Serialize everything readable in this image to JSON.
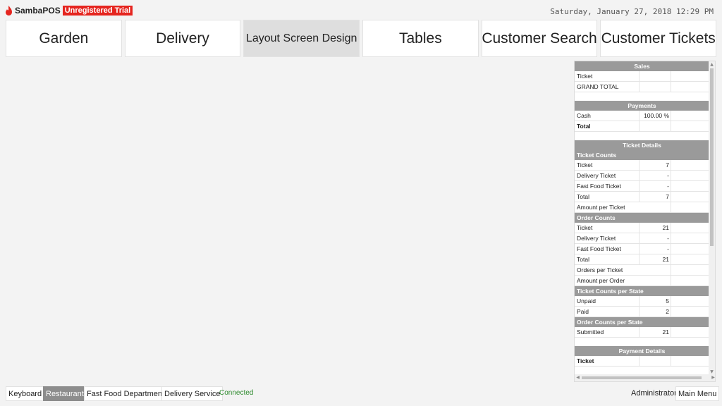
{
  "app": {
    "name": "SambaPOS",
    "trial_badge": "Unregistered Trial",
    "datetime": "Saturday, January 27, 2018 12:29 PM",
    "brand_color": "#e5251f"
  },
  "nav": {
    "garden": "Garden",
    "delivery": "Delivery",
    "layout_screen_design": "Layout Screen Design",
    "tables": "Tables",
    "customer_search": "Customer Search",
    "customer_tickets": "Customer Tickets",
    "active": "Layout Screen Design"
  },
  "report": {
    "sales": {
      "title": "Sales",
      "ticket": "Ticket",
      "grand_total": "GRAND TOTAL"
    },
    "payments": {
      "title": "Payments",
      "cash": "Cash",
      "cash_value": "100.00 %",
      "total": "Total"
    },
    "ticket_details": {
      "title": "Ticket Details",
      "ticket_counts": {
        "title": "Ticket Counts",
        "ticket": "Ticket",
        "ticket_value": "7",
        "delivery_ticket": "Delivery Ticket",
        "delivery_ticket_value": "-",
        "fast_food_ticket": "Fast Food Ticket",
        "fast_food_ticket_value": "-",
        "total": "Total",
        "total_value": "7",
        "amount_per_ticket": "Amount per Ticket"
      },
      "order_counts": {
        "title": "Order Counts",
        "ticket": "Ticket",
        "ticket_value": "21",
        "delivery_ticket": "Delivery Ticket",
        "delivery_ticket_value": "-",
        "fast_food_ticket": "Fast Food Ticket",
        "fast_food_ticket_value": "-",
        "total": "Total",
        "total_value": "21",
        "orders_per_ticket": "Orders per Ticket",
        "amount_per_order": "Amount per Order"
      },
      "ticket_counts_per_state": {
        "title": "Ticket Counts per State",
        "unpaid": "Unpaid",
        "unpaid_value": "5",
        "paid": "Paid",
        "paid_value": "2"
      },
      "order_counts_per_state": {
        "title": "Order Counts per State",
        "submitted": "Submitted",
        "submitted_value": "21"
      }
    },
    "payment_details": {
      "title": "Payment Details",
      "ticket": "Ticket"
    }
  },
  "bottom": {
    "keyboard": "Keyboard",
    "restaurant": "Restaurant",
    "fast_food_department": "Fast Food Department",
    "delivery_service": "Delivery Service",
    "status": "Connected",
    "status_color": "#2e8b2e",
    "user": "Administrator",
    "main_menu": "Main Menu",
    "active_department": "Restaurant"
  }
}
